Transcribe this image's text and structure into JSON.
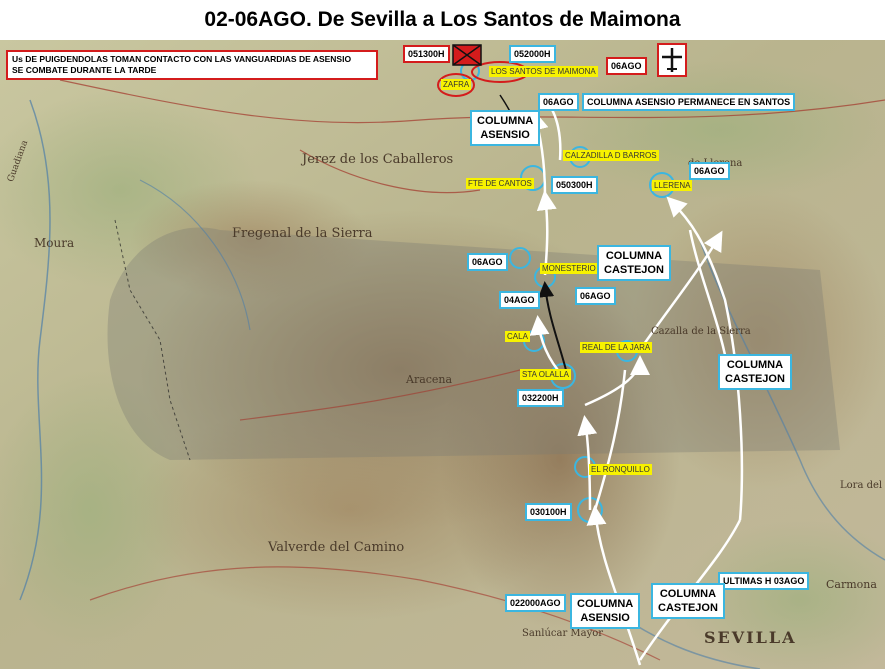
{
  "title": "02-06AGO. De Sevilla a Los Santos de Maimona",
  "note": {
    "line1": "Us DE PUIGDENDOLAS TOMAN CONTACTO CON LAS VANGUARDIAS DE ASENSIO",
    "line2": "SE COMBATE DURANTE LA TARDE"
  },
  "combat_time": "051300H",
  "combat_icon": "battle-crossed-box-icon",
  "air_icon": "aircraft-icon",
  "time_labels": {
    "t052000": "052000H",
    "t06ago_air": "06AGO",
    "t06ago_santos": "06AGO",
    "column_remains": "COLUMNA ASENSIO PERMANECE EN SANTOS",
    "t06ago_llerena": "06AGO",
    "t050300": "050300H",
    "t06ago_west": "06AGO",
    "t06ago_mon": "06AGO",
    "t04ago": "04AGO",
    "t032200": "032200H",
    "t030100": "030100H",
    "t022000": "022000AGO",
    "ultimas": "ULTIMAS H  03AGO"
  },
  "columns": {
    "asensio_north_1": "COLUMNA",
    "asensio_north_2": "ASENSIO",
    "castejon_mid_1": "COLUMNA",
    "castejon_mid_2": "CASTEJON",
    "castejon_east_1": "COLUMNA",
    "castejon_east_2": "CASTEJON",
    "asensio_south_1": "COLUMNA",
    "asensio_south_2": "ASENSIO",
    "castejon_south_1": "COLUMNA",
    "castejon_south_2": "CASTEJON"
  },
  "towns": {
    "zafra": "ZAFRA",
    "santos": "LOS SANTOS DE MAIMONA",
    "calzadilla": "CALZADILLA D BARROS",
    "fte_cantos": "FTE DE CANTOS",
    "llerena": "LLERENA",
    "monesterio": "MONESTERIO",
    "cala": "CALA",
    "real_jara": "REAL DE LA JARA",
    "sta_olalla": "STA OLALLA",
    "ronquillo": "EL RONQUILLO"
  },
  "map_places": {
    "jerez": "Jerez de los Caballeros",
    "fregenal": "Fregenal de la Sierra",
    "moura": "Moura",
    "aracena": "Aracena",
    "valverde": "Valverde del Camino",
    "sevilla": "SEVILLA",
    "cazalla": "Cazalla de la Sierra",
    "carmona": "Carmona",
    "lora": "Lora del Rio",
    "guadiana": "Guadiana",
    "sanlucar": "Sanlúcar Mayor",
    "llerena_map": "de Llerena"
  },
  "colors": {
    "route_white": "#ffffff",
    "route_black": "#111111",
    "box_border": "#3bb6e0",
    "red": "#d41c1c",
    "highlight": "#f7f200"
  }
}
